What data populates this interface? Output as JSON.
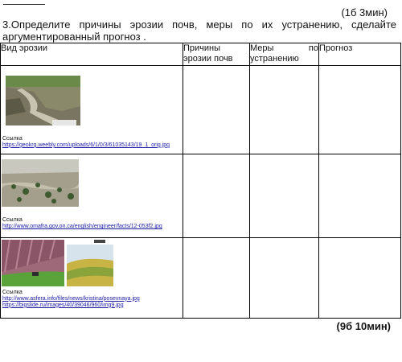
{
  "header": {
    "score": "(1б 3мин)",
    "question": "3.Определите причины эрозии почв, меры по их устранению, сделайте аргументированный прогноз ."
  },
  "table": {
    "columns": [
      "Вид эрозии",
      "Причины эрозии почв",
      "Меры",
      "по",
      "устранению",
      "Прогноз"
    ],
    "rows": [
      {
        "caption": "Ссылка",
        "links": [
          "https://geokrg.weebly.com/uploads/6/1/0/3/61035143/19_1_orig.jpg"
        ]
      },
      {
        "caption": "Ссылка",
        "links": [
          "http://www.omafra.gov.on.ca/english/engineer/facts/12-053f2.jpg"
        ]
      },
      {
        "caption": "Ссылка",
        "links": [
          "http://www.asfera.info/files/news/kristina/posevnaya.jpg",
          "https://bigslide.ru/images/40/39046/960/img9.jpg"
        ]
      }
    ]
  },
  "footer": {
    "score": "(9б 10мин)"
  }
}
